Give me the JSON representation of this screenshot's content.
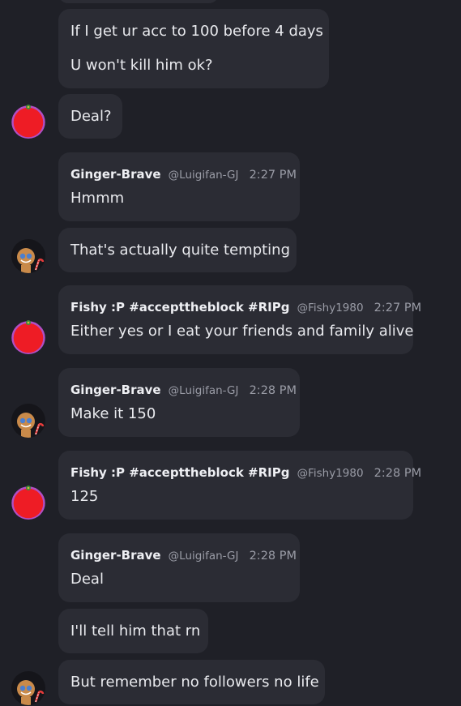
{
  "colors": {
    "background": "#1f2027",
    "bubble": "#2b2c34",
    "text": "#e9eaee",
    "muted": "#9a9ca6"
  },
  "messages": [
    {
      "type": "continuation",
      "lines": [
        "If I get ur acc to 100 before 4 days",
        "U won't kill him ok?"
      ]
    },
    {
      "type": "continuation",
      "avatar": "fishy-avatar",
      "lines": [
        "Deal?"
      ]
    },
    {
      "type": "header",
      "author": "Ginger-Brave",
      "handle": "@Luigifan-GJ",
      "time": "2:27 PM",
      "lines": [
        "Hmmm"
      ]
    },
    {
      "type": "continuation",
      "avatar": "gingerbread-avatar",
      "lines": [
        "That's actually quite tempting"
      ]
    },
    {
      "type": "header",
      "avatar": "fishy-avatar",
      "author": "Fishy :P #accepttheblock #RIPg",
      "handle": "@Fishy1980",
      "time": "2:27 PM",
      "lines": [
        "Either yes or I eat your friends and family alive"
      ]
    },
    {
      "type": "header",
      "avatar": "gingerbread-avatar",
      "author": "Ginger-Brave",
      "handle": "@Luigifan-GJ",
      "time": "2:28 PM",
      "lines": [
        "Make it 150"
      ]
    },
    {
      "type": "header",
      "avatar": "fishy-avatar",
      "author": "Fishy :P #accepttheblock #RIPg",
      "handle": "@Fishy1980",
      "time": "2:28 PM",
      "lines": [
        "125"
      ]
    },
    {
      "type": "header",
      "author": "Ginger-Brave",
      "handle": "@Luigifan-GJ",
      "time": "2:28 PM",
      "lines": [
        "Deal"
      ]
    },
    {
      "type": "continuation",
      "lines": [
        "I'll tell him that rn"
      ]
    },
    {
      "type": "continuation",
      "avatar": "gingerbread-avatar",
      "lines": [
        "But remember no followers no life"
      ]
    }
  ]
}
